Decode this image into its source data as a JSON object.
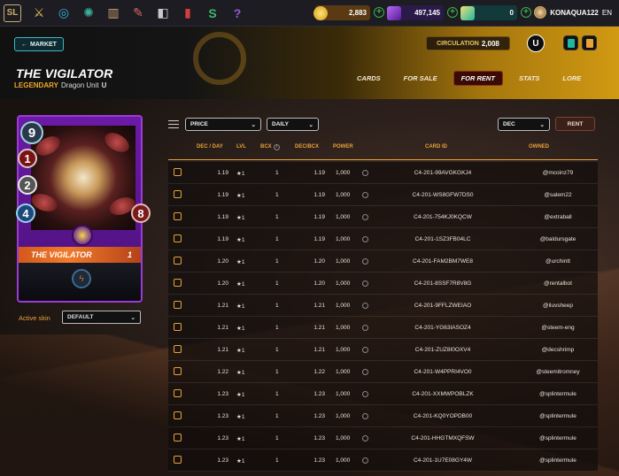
{
  "topbar": {
    "logo_text": "SL",
    "nav_icons": [
      "sword-icon",
      "swirl-icon",
      "globe-icon",
      "map-icon",
      "sword2-icon",
      "chest-icon",
      "banner-icon",
      "s-logo-icon",
      "help-icon"
    ],
    "credits": "2,883",
    "dec": "497,145",
    "sps": "0",
    "username": "KONAQUA122",
    "lang": "EN",
    "colors": {
      "credits": "#f3b51e",
      "dec": "#7a3bd4",
      "sps": "#1fb8a0"
    }
  },
  "header": {
    "market_label": "MARKET",
    "card_name": "THE VIGILATOR",
    "rarity": "LEGENDARY",
    "type": "Dragon Unit",
    "edition_mark": "U",
    "circulation_label": "CIRCULATION",
    "circulation_value": "2,008",
    "tabs": [
      {
        "label": "CARDS",
        "active": false
      },
      {
        "label": "FOR SALE",
        "active": false
      },
      {
        "label": "FOR RENT",
        "active": true
      },
      {
        "label": "STATS",
        "active": false
      },
      {
        "label": "LORE",
        "active": false
      }
    ]
  },
  "card": {
    "mana": "9",
    "attack": "1",
    "speed": "2",
    "armor": "4",
    "health": "8",
    "name": "THE VIGILATOR",
    "level": "1"
  },
  "skin": {
    "label": "Active skin",
    "value": "DEFAULT"
  },
  "filters": {
    "sort": "PRICE",
    "period": "DAILY",
    "currency": "DEC",
    "rent_label": "RENT"
  },
  "table": {
    "headers": {
      "dec_day": "DEC / DAY",
      "lvl": "LVL",
      "bcx": "BCX",
      "dec_bcx": "DEC/BCX",
      "power": "POWER",
      "card_id": "CARD ID",
      "owned": "OWNED"
    },
    "rows": [
      {
        "dec": "1.19",
        "lvl": "★1",
        "bcx": "1",
        "decbcx": "1.19",
        "power": "1,000",
        "id": "C4-201-99AVGKGKJ4",
        "owner": "@mcoinz79"
      },
      {
        "dec": "1.19",
        "lvl": "★1",
        "bcx": "1",
        "decbcx": "1.19",
        "power": "1,000",
        "id": "C4-201-WS8GFW7DS0",
        "owner": "@salem22"
      },
      {
        "dec": "1.19",
        "lvl": "★1",
        "bcx": "1",
        "decbcx": "1.19",
        "power": "1,000",
        "id": "C4-201-754KJ0KQCW",
        "owner": "@extraball"
      },
      {
        "dec": "1.19",
        "lvl": "★1",
        "bcx": "1",
        "decbcx": "1.19",
        "power": "1,000",
        "id": "C4-201-1SZ3FB04LC",
        "owner": "@baldursgate"
      },
      {
        "dec": "1.20",
        "lvl": "★1",
        "bcx": "1",
        "decbcx": "1.20",
        "power": "1,000",
        "id": "C4-201-FAM2BM7WE8",
        "owner": "@urchintt"
      },
      {
        "dec": "1.20",
        "lvl": "★1",
        "bcx": "1",
        "decbcx": "1.20",
        "power": "1,000",
        "id": "C4-201-8SSF7R8V8G",
        "owner": "@rentalbot"
      },
      {
        "dec": "1.21",
        "lvl": "★1",
        "bcx": "1",
        "decbcx": "1.21",
        "power": "1,000",
        "id": "C4-201-9FFLZWEIAO",
        "owner": "@iluvsheep"
      },
      {
        "dec": "1.21",
        "lvl": "★1",
        "bcx": "1",
        "decbcx": "1.21",
        "power": "1,000",
        "id": "C4-201-YG63IASOZ4",
        "owner": "@steem-eng"
      },
      {
        "dec": "1.21",
        "lvl": "★1",
        "bcx": "1",
        "decbcx": "1.21",
        "power": "1,000",
        "id": "C4-201-ZUZ8I0OXV4",
        "owner": "@decshrimp"
      },
      {
        "dec": "1.22",
        "lvl": "★1",
        "bcx": "1",
        "decbcx": "1.22",
        "power": "1,000",
        "id": "C4-201-W4PPRI4VO0",
        "owner": "@steemitromney"
      },
      {
        "dec": "1.23",
        "lvl": "★1",
        "bcx": "1",
        "decbcx": "1.23",
        "power": "1,000",
        "id": "C4-201-XXMWPOBLZK",
        "owner": "@splintermule"
      },
      {
        "dec": "1.23",
        "lvl": "★1",
        "bcx": "1",
        "decbcx": "1.23",
        "power": "1,000",
        "id": "C4-201-KQ0YOPDB00",
        "owner": "@splintermule"
      },
      {
        "dec": "1.23",
        "lvl": "★1",
        "bcx": "1",
        "decbcx": "1.23",
        "power": "1,000",
        "id": "C4-201-HHGTMXQFSW",
        "owner": "@splintermule"
      },
      {
        "dec": "1.23",
        "lvl": "★1",
        "bcx": "1",
        "decbcx": "1.23",
        "power": "1,000",
        "id": "C4-201-1U7E08GY4W",
        "owner": "@splintermule"
      }
    ]
  }
}
